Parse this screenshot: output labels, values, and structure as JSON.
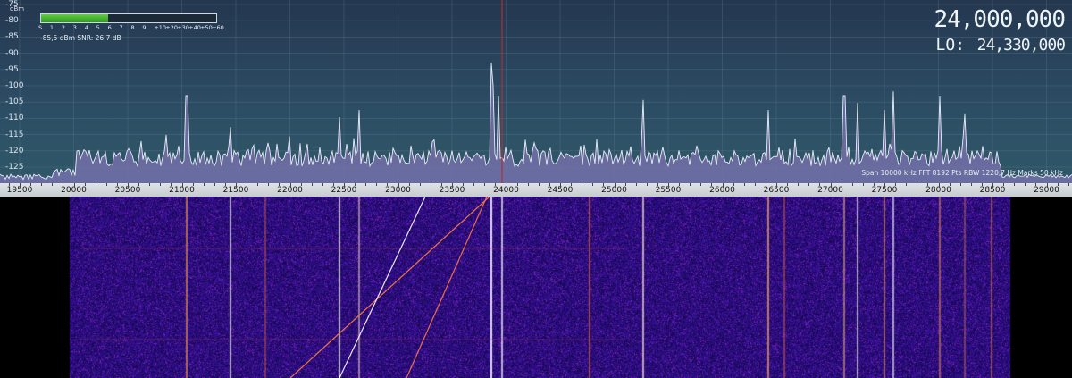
{
  "spectrum": {
    "unit_label": "dBm",
    "y_ticks": [
      "-75",
      "-80",
      "-85",
      "-90",
      "-95",
      "-100",
      "-105",
      "-110",
      "-115",
      "-120",
      "-125"
    ],
    "trace_color": "#e8eef6",
    "fill_color": "#7a72b0",
    "marker_color": "#b03030"
  },
  "smeter": {
    "unit": "dBm",
    "scale": [
      "S",
      "1",
      "2",
      "3",
      "4",
      "5",
      "6",
      "7",
      "8",
      "9",
      "+10",
      "+20",
      "+30",
      "+40",
      "+50",
      "+60"
    ],
    "level": 0.385,
    "readout": "-85,5 dBm     SNR: 26,7 dB"
  },
  "freq": {
    "main": "24,000,000",
    "lo_label": "LO:",
    "lo_value": "24,330,000"
  },
  "status": "Span 10000 kHz   FFT 8192 Pts   RBW 1220,7 Hz   Marks 50 kHz",
  "axis": {
    "labels": [
      "19500",
      "20000",
      "20500",
      "21000",
      "21500",
      "22000",
      "22500",
      "23000",
      "23500",
      "24000",
      "24500",
      "25000",
      "25500",
      "26000",
      "26500",
      "27000",
      "27500",
      "28000",
      "28500",
      "29000"
    ]
  }
}
